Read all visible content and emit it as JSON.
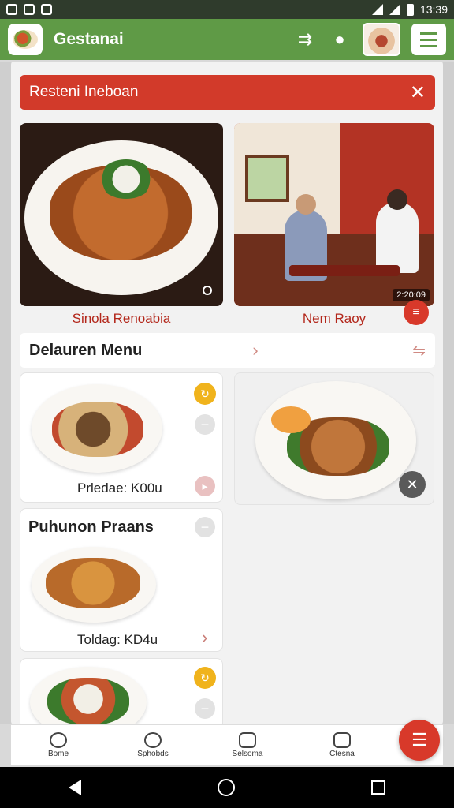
{
  "status_bar": {
    "time": "13:39"
  },
  "app_bar": {
    "title": "Gestanai",
    "icons": [
      "logo-icon",
      "share-icon",
      "profile-icon",
      "avatar-thumb",
      "menu-icon"
    ]
  },
  "banner": {
    "text": "Resteni Ineboan",
    "close": "✕"
  },
  "featured": [
    {
      "caption": "Sinola Renoabia",
      "badge": "",
      "kind": "food-photo"
    },
    {
      "caption": "Nem Raoy",
      "badge": "2:20:09",
      "kind": "restaurant-photo"
    }
  ],
  "section": {
    "title": "Delauren Menu",
    "chevron": "›",
    "filter": "⇋"
  },
  "menu_items": [
    {
      "title": "",
      "price": "Prledae:  K00u",
      "action": "↻"
    },
    {
      "title": "",
      "price": "",
      "action": "✕"
    },
    {
      "title": "Puhunon Praans",
      "price": "Toldag:  KD4u",
      "action": "›"
    },
    {
      "title": "",
      "price": "",
      "action": "↻"
    }
  ],
  "bottom_nav": [
    {
      "label": "Bome",
      "icon": "home-icon"
    },
    {
      "label": "Sphobds",
      "icon": "settings-icon"
    },
    {
      "label": "Selsoma",
      "icon": "edit-icon"
    },
    {
      "label": "Ctesna",
      "icon": "calendar-icon"
    }
  ],
  "fab": {
    "glyph": "☰"
  },
  "colors": {
    "app_green": "#5f9a46",
    "accent_red": "#d23a2a",
    "price_text": "#222222",
    "caption_red": "#b3271b"
  }
}
